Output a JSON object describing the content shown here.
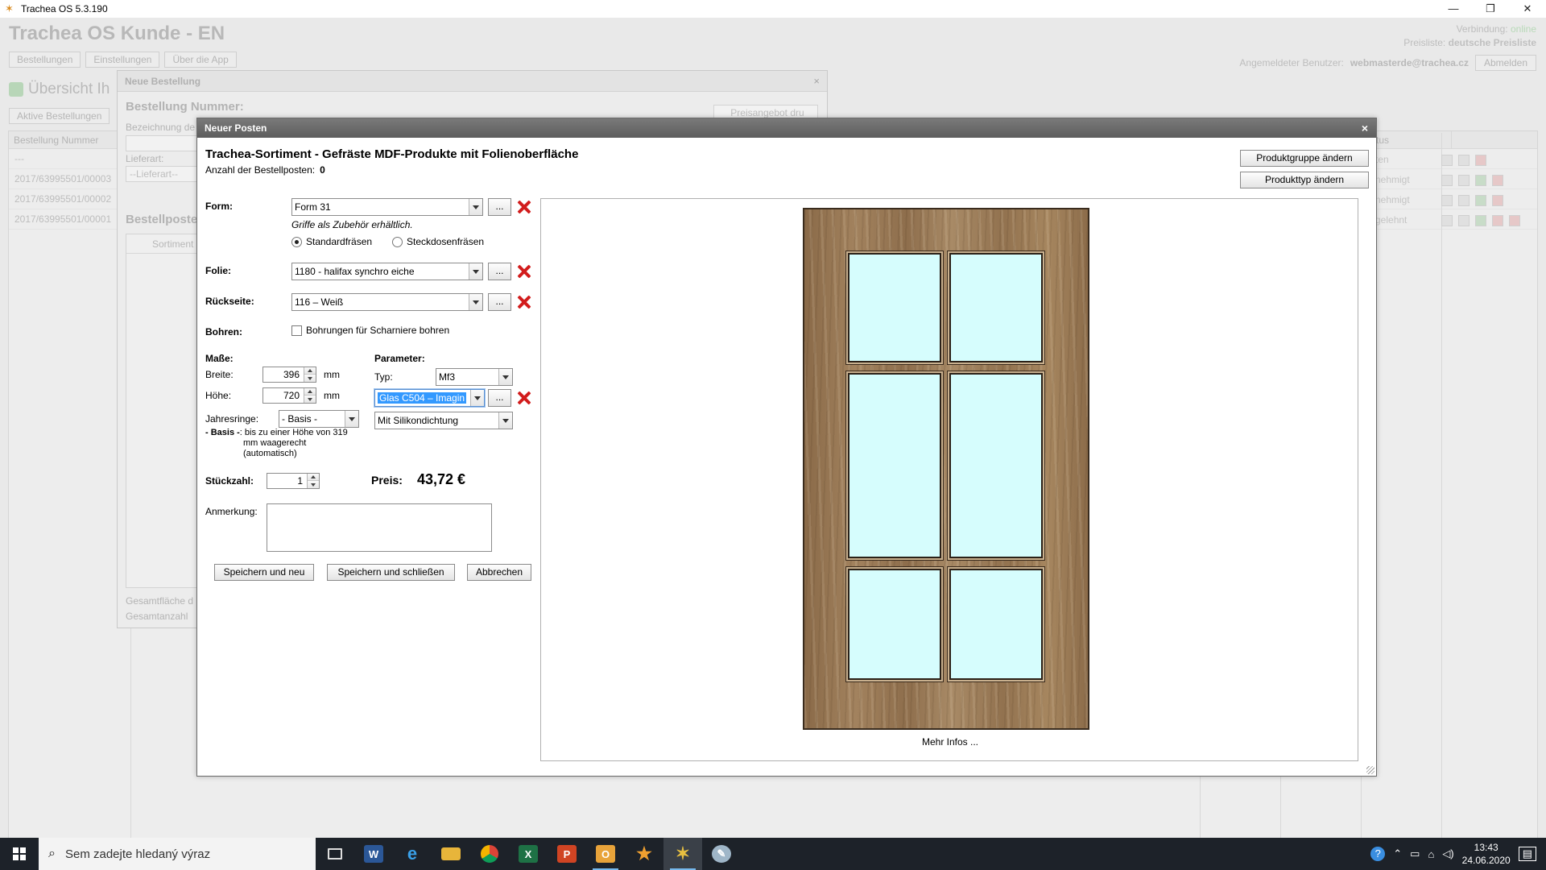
{
  "window": {
    "title": "Trachea OS 5.3.190",
    "controls": [
      "—",
      "❐",
      "✕"
    ]
  },
  "background_app": {
    "title": "Trachea OS Kunde - EN",
    "nav_buttons": [
      "Bestellungen",
      "Einstellungen",
      "Über die App"
    ],
    "connection_label": "Verbindung:",
    "connection_value": "online",
    "pricelist_label": "Preisliste:",
    "pricelist_value": "deutsche Preisliste",
    "user_label": "Angemeldeter Benutzer:",
    "user_value": "webmasterde@trachea.cz",
    "logout_button": "Abmelden",
    "overview_title": "Übersicht Ih",
    "active_orders_tab": "Aktive Bestellungen",
    "table_header_number": "Bestellung Nummer",
    "table_header_status": "tus",
    "rows": [
      "---",
      "2017/63995501/00003",
      "2017/63995501/00002",
      "2017/63995501/00001"
    ],
    "status_values": [
      "ten",
      "nehmigt",
      "nehmigt",
      "gelehnt"
    ]
  },
  "order_dialog": {
    "title": "Neue Bestellung",
    "close": "×",
    "order_number_label": "Bestellung Nummer:",
    "designation_label": "Bezeichnung de",
    "delivery_label": "Lieferart:",
    "delivery_value": "--Lieferart--",
    "quote_button": "Preisangebot dru",
    "items_label": "Bestellposter",
    "items_col": "Sortiment",
    "total_area": "Gesamtfläche d",
    "total_count": "Gesamtanzahl"
  },
  "item_dialog": {
    "title": "Neuer Posten",
    "close": "×",
    "heading": "Trachea-Sortiment - Gefräste MDF-Produkte mit Folienoberfläche",
    "count_label": "Anzahl der Bestellposten:",
    "count_value": "0",
    "btn_product_group": "Produktgruppe ändern",
    "btn_product_type": "Produkttyp ändern",
    "form_label": "Form:",
    "form_value": "Form 31",
    "form_hint": "Griffe als Zubehör erhältlich.",
    "radio_standard": "Standardfräsen",
    "radio_socket": "Steckdosenfräsen",
    "foil_label": "Folie:",
    "foil_value": "1180 - halifax synchro eiche",
    "back_label": "Rückseite:",
    "back_value": "116 – Weiß",
    "drill_label": "Bohren:",
    "drill_check": "Bohrungen für Scharniere bohren",
    "dims_label": "Maße:",
    "width_label": "Breite:",
    "width_value": "396",
    "height_label": "Höhe:",
    "height_value": "720",
    "unit": "mm",
    "rings_label": "Jahresringe:",
    "rings_value": "- Basis -",
    "rings_note_bold": "- Basis -",
    "rings_note_rest": ": bis zu einer Höhe von 319",
    "rings_note_line2": "mm waagerecht",
    "rings_note_line3": "(automatisch)",
    "params_label": "Parameter:",
    "type_label": "Typ:",
    "type_value": "Mf3",
    "glass_value": "Glas C504 – Imagin",
    "seal_value": "Mit Silikondichtung",
    "qty_label": "Stückzahl:",
    "qty_value": "1",
    "price_label": "Preis:",
    "price_value": "43,72 €",
    "remark_label": "Anmerkung:",
    "btn_save_new": "Speichern und neu",
    "btn_save_close": "Speichern und schließen",
    "btn_cancel": "Abbrechen",
    "dots": "...",
    "more_info": "Mehr Infos ..."
  },
  "taskbar": {
    "search_placeholder": "Sem zadejte hledaný výraz",
    "apps": [
      "task-view",
      "word",
      "edge",
      "explorer",
      "chrome",
      "excel",
      "powerpoint",
      "outlook",
      "star-app",
      "trachea",
      "paint"
    ],
    "time": "13:43",
    "date": "24.06.2020"
  },
  "colors": {
    "delete_red": "#d21c1c",
    "glass": "#d6fdfd",
    "wood": "#9a7a56",
    "dialog_title": "#6b6b6b",
    "taskbar": "#1d2229"
  }
}
